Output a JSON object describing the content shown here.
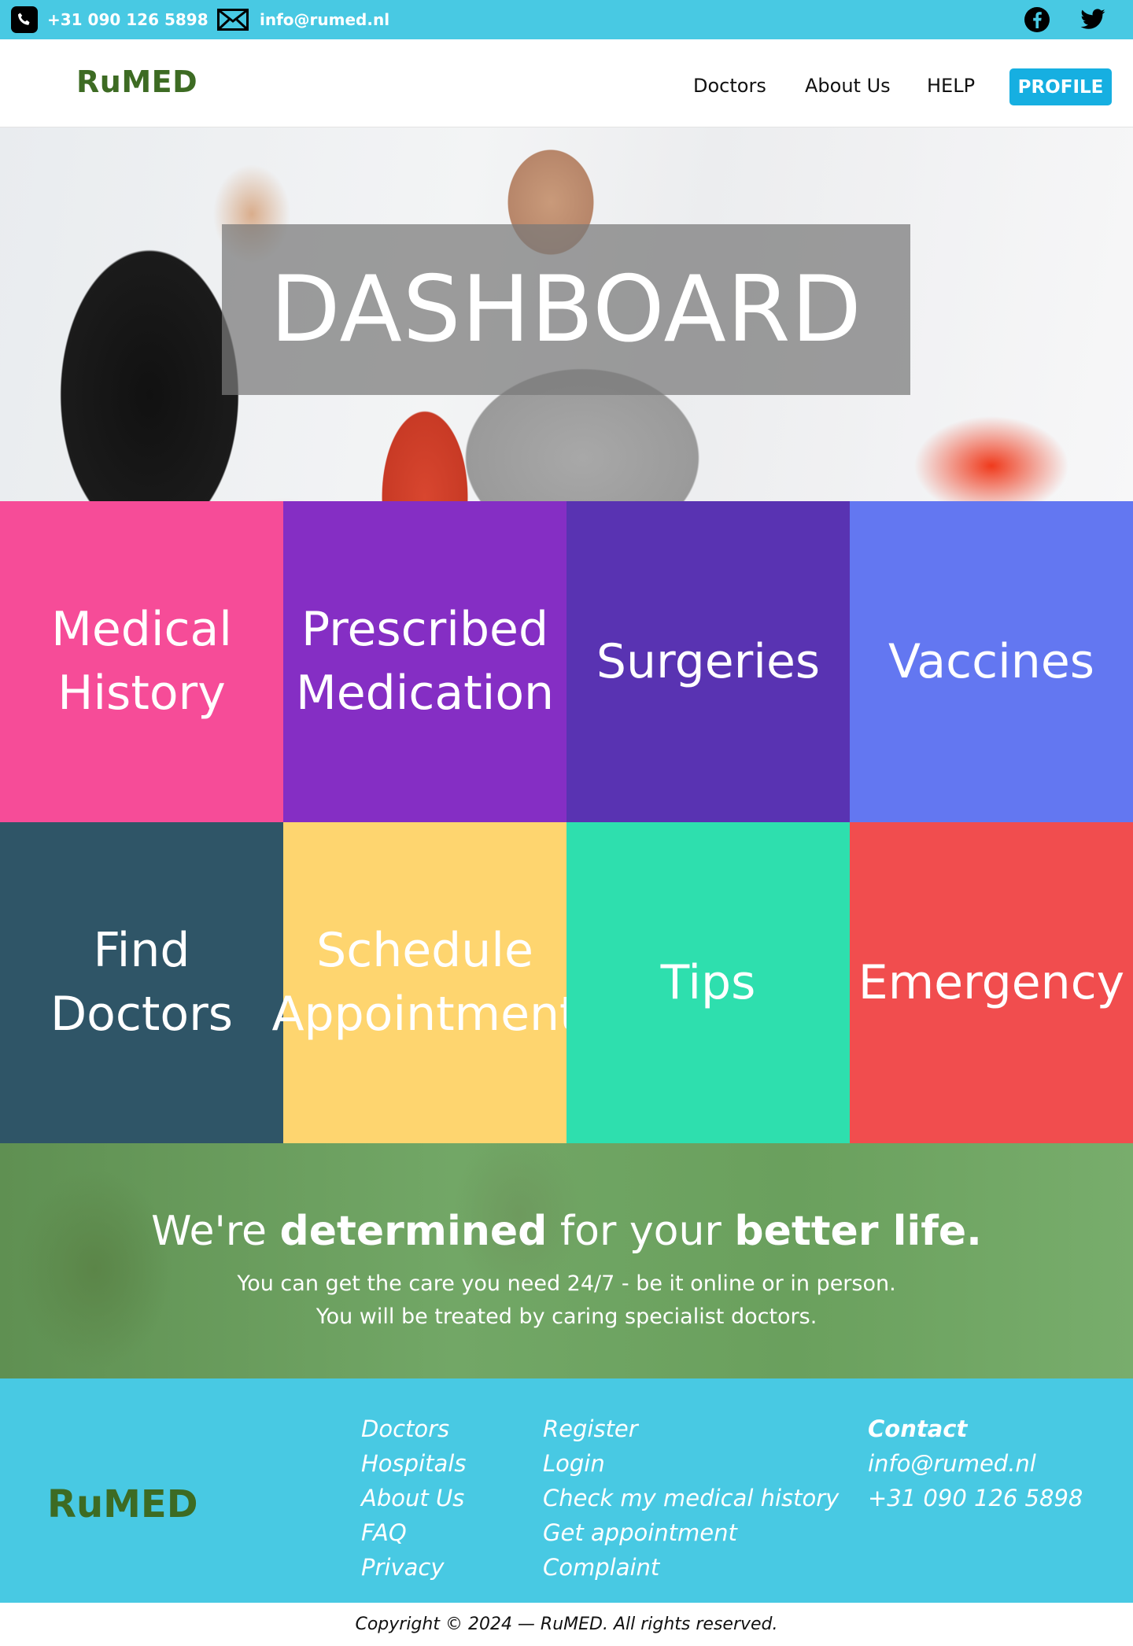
{
  "topbar": {
    "phone": "+31 090 126 5898",
    "email": "info@rumed.nl",
    "social": [
      "facebook-icon",
      "twitter-icon"
    ]
  },
  "nav": {
    "logo": "RuMED",
    "links": [
      "Doctors",
      "About Us",
      "HELP"
    ],
    "profile_label": "PROFILE"
  },
  "hero": {
    "title": "DASHBOARD"
  },
  "tiles": [
    {
      "lines": [
        "Medical",
        "History"
      ],
      "color": "#f64c98"
    },
    {
      "lines": [
        "Prescribed",
        "Medication"
      ],
      "color": "#852ec4"
    },
    {
      "lines": [
        "Surgeries"
      ],
      "color": "#5933b2"
    },
    {
      "lines": [
        "Vaccines"
      ],
      "color": "#6377f1"
    },
    {
      "lines": [
        "Find",
        "Doctors"
      ],
      "color": "#2f5567"
    },
    {
      "lines": [
        "Schedule",
        "Appointment"
      ],
      "color": "#fed56f"
    },
    {
      "lines": [
        "Tips"
      ],
      "color": "#2edfae"
    },
    {
      "lines": [
        "Emergency"
      ],
      "color": "#f14d4e"
    }
  ],
  "banner": {
    "tagline_pre": "We're ",
    "tagline_bold1": "determined",
    "tagline_mid": " for your ",
    "tagline_bold2": "better life.",
    "line1": "You can get the care you need 24/7 - be it online or in person.",
    "line2": "You will be treated by caring specialist doctors."
  },
  "footer": {
    "logo": "RuMED",
    "col1": [
      "Doctors",
      "Hospitals",
      "About Us",
      "FAQ",
      "Privacy"
    ],
    "col2": [
      "Register",
      "Login",
      "Check my medical history",
      "Get appointment",
      "Complaint"
    ],
    "contact_title": "Contact",
    "contact_email": "info@rumed.nl",
    "contact_phone": "+31 090 126 5898"
  },
  "copyright": "Copyright © 2024 — RuMED. All rights reserved."
}
